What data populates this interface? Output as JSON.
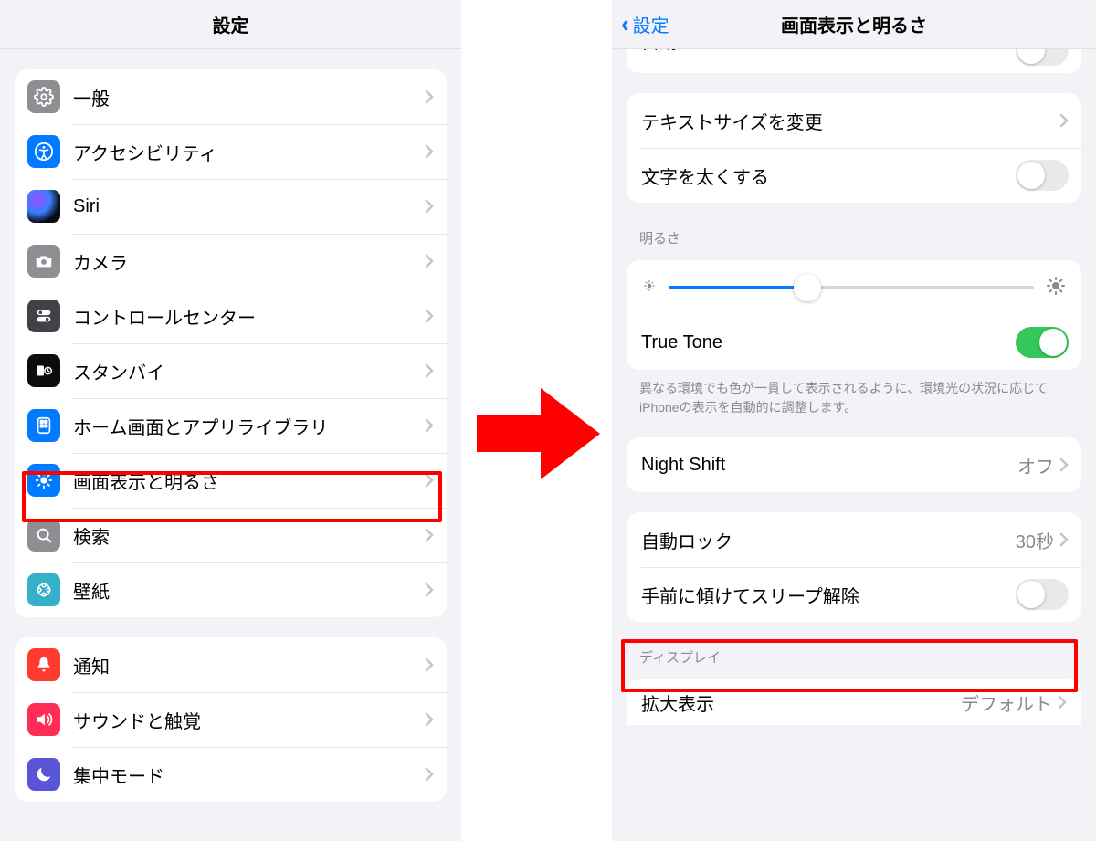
{
  "left": {
    "title": "設定",
    "group1": [
      {
        "id": "general",
        "label": "一般"
      },
      {
        "id": "accessibility",
        "label": "アクセシビリティ"
      },
      {
        "id": "siri",
        "label": "Siri"
      },
      {
        "id": "camera",
        "label": "カメラ"
      },
      {
        "id": "control",
        "label": "コントロールセンター"
      },
      {
        "id": "standby",
        "label": "スタンバイ"
      },
      {
        "id": "home",
        "label": "ホーム画面とアプリライブラリ"
      },
      {
        "id": "display",
        "label": "画面表示と明るさ"
      },
      {
        "id": "search",
        "label": "検索"
      },
      {
        "id": "wallpaper",
        "label": "壁紙"
      }
    ],
    "group2": [
      {
        "id": "notifications",
        "label": "通知"
      },
      {
        "id": "sounds",
        "label": "サウンドと触覚"
      },
      {
        "id": "focus",
        "label": "集中モード"
      }
    ]
  },
  "right": {
    "back": "設定",
    "title": "画面表示と明るさ",
    "peek_label": "自動",
    "text_size": "テキストサイズを変更",
    "bold_text": "文字を太くする",
    "brightness_header": "明るさ",
    "true_tone": "True Tone",
    "true_tone_note": "異なる環境でも色が一貫して表示されるように、環境光の状況に応じてiPhoneの表示を自動的に調整します。",
    "night_shift": "Night Shift",
    "night_shift_value": "オフ",
    "auto_lock": "自動ロック",
    "auto_lock_value": "30秒",
    "raise_to_wake": "手前に傾けてスリープ解除",
    "display_header": "ディスプレイ",
    "zoom": "拡大表示",
    "zoom_value": "デフォルト"
  }
}
